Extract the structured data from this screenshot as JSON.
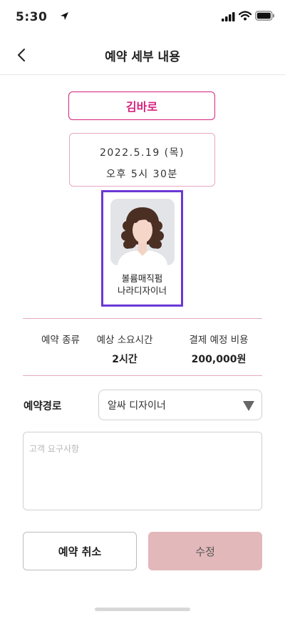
{
  "status_bar": {
    "time": "5:30"
  },
  "header": {
    "title": "예약 세부 내용"
  },
  "reservation": {
    "customer_name": "김바로",
    "date": "2022.5.19 (목)",
    "time": "오후 5시 30분"
  },
  "designer": {
    "line1": "볼륨매직펌",
    "line2": "나라디자이너"
  },
  "info": {
    "type_label": "예약 종류",
    "duration_label": "예상 소요시간",
    "duration_value": "2시간",
    "cost_label": "결제 예정 비용",
    "cost_value": "200,000원"
  },
  "route": {
    "label": "예약경로",
    "value": "알싸 디자이너"
  },
  "requests": {
    "placeholder": "고객 요구사항"
  },
  "buttons": {
    "cancel": "예약 취소",
    "edit": "수정"
  },
  "colors": {
    "accent": "#d6237f",
    "selection": "#6a38d6",
    "edit_button": "#e2b8bb"
  }
}
